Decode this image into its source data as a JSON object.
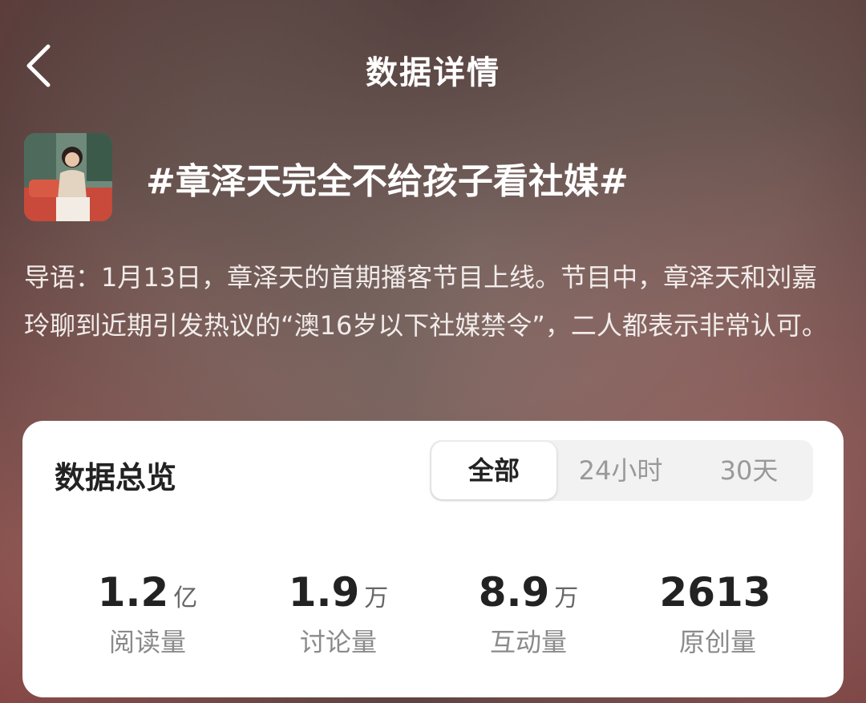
{
  "header": {
    "title": "数据详情"
  },
  "topic": {
    "title": "#章泽天完全不给孩子看社媒#",
    "intro": "导语：1月13日，章泽天的首期播客节目上线。节目中，章泽天和刘嘉玲聊到近期引发热议的“澳16岁以下社媒禁令”，二人都表示非常认可。"
  },
  "overview": {
    "title": "数据总览",
    "tabs": [
      {
        "label": "全部",
        "active": true
      },
      {
        "label": "24小时",
        "active": false
      },
      {
        "label": "30天",
        "active": false
      }
    ],
    "stats": [
      {
        "value": "1.2",
        "unit": "亿",
        "label": "阅读量"
      },
      {
        "value": "1.9",
        "unit": "万",
        "label": "讨论量"
      },
      {
        "value": "8.9",
        "unit": "万",
        "label": "互动量"
      },
      {
        "value": "2613",
        "unit": "",
        "label": "原创量"
      }
    ]
  }
}
